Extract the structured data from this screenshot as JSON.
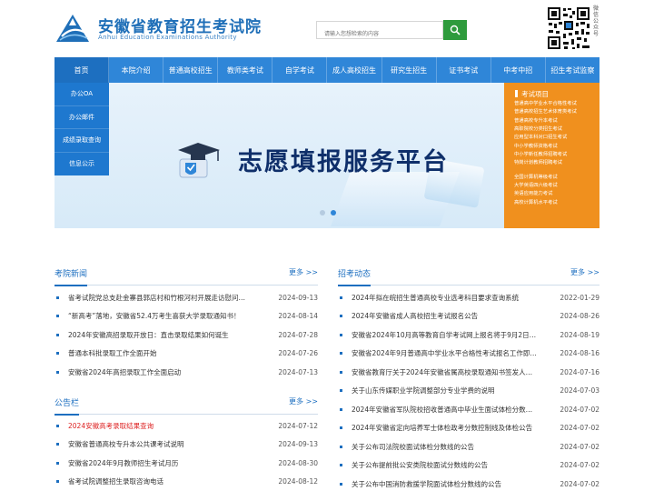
{
  "header": {
    "title": "安徽省教育招生考试院",
    "subtitle": "Anhui Education Examinations Authority",
    "search_placeholder": "请输入您想检索的内容",
    "qr_label": "微信公众号"
  },
  "nav": [
    {
      "label": "首页"
    },
    {
      "label": "本院介绍"
    },
    {
      "label": "普通高校招生"
    },
    {
      "label": "教师类考试"
    },
    {
      "label": "自学考试"
    },
    {
      "label": "成人高校招生"
    },
    {
      "label": "研究生招生"
    },
    {
      "label": "证书考试"
    },
    {
      "label": "中考中招"
    },
    {
      "label": "招生考试监察"
    }
  ],
  "quick_menu": [
    {
      "label": "办公OA"
    },
    {
      "label": "办公邮件"
    },
    {
      "label": "成绩录取查询"
    },
    {
      "label": "信息公示"
    }
  ],
  "banner": {
    "title": "志愿填报服务平台"
  },
  "exam_panel": {
    "title": "考试项目",
    "group1": [
      "普通高中学业水平合格性考试",
      "普通高校招生艺术体育类考试",
      "普通高校专升本考试",
      "高职院校分类招生考试",
      "应用型本科对口招生考试",
      "中小学教师资格考试",
      "中小学新任教师招聘考试",
      "特岗计划教师招聘考试"
    ],
    "group2": [
      "全国计算机等级考试",
      "大学英语四六级考试",
      "英语应用能力考试",
      "高校计算机水平考试"
    ]
  },
  "news": {
    "title": "考院新闻",
    "more": "更多 >>",
    "items": [
      {
        "title": "省考试院党总支赴金寨县郭店村和竹根河村开展走访慰问…",
        "date": "2024-09-13"
      },
      {
        "title": "“新高考”落地，安徽省52.4万考生喜获大学录取通知书！",
        "date": "2024-08-14"
      },
      {
        "title": "2024年安徽高招录取开放日：直击录取结果如何诞生",
        "date": "2024-07-28"
      },
      {
        "title": "普通本科批录取工作全面开始",
        "date": "2024-07-26"
      },
      {
        "title": "安徽省2024年高招录取工作全面启动",
        "date": "2024-07-13"
      }
    ]
  },
  "notice": {
    "title": "公告栏",
    "more": "更多 >>",
    "items": [
      {
        "title": "2024安徽高考录取结果查询",
        "date": "2024-07-12"
      },
      {
        "title": "安徽省普通高校专升本公共课考试说明",
        "date": "2024-09-13"
      },
      {
        "title": "安徽省2024年9月教师招生考试月历",
        "date": "2024-08-30"
      },
      {
        "title": "省考试院调整招生录取咨询电话",
        "date": "2024-08-12"
      }
    ]
  },
  "admissions": {
    "title": "招考动态",
    "more": "更多 >>",
    "items": [
      {
        "title": "2024年拟在皖招生普通高校专业选考科目要求查询系统",
        "date": "2022-01-29"
      },
      {
        "title": "2024年安徽省成人高校招生考试报名公告",
        "date": "2024-08-26"
      },
      {
        "title": "安徽省2024年10月高等教育自学考试网上报名将于9月2日…",
        "date": "2024-08-19"
      },
      {
        "title": "安徽省2024年9月普通高中学业水平合格性考试报名工作即…",
        "date": "2024-08-16"
      },
      {
        "title": "安徽省教育厅关于2024年安徽省属高校录取通知书签发人…",
        "date": "2024-07-16"
      },
      {
        "title": "关于山东传媒职业学院调整部分专业学费的说明",
        "date": "2024-07-03"
      },
      {
        "title": "2024年安徽省军队院校招收普通高中毕业生面试体检分数…",
        "date": "2024-07-02"
      },
      {
        "title": "2024年安徽省定向培养军士体检政考分数控制线及体检公告",
        "date": "2024-07-02"
      },
      {
        "title": "关于公布司法院校面试体检分数线的公告",
        "date": "2024-07-02"
      },
      {
        "title": "关于公布提前批公安类院校面试分数线的公告",
        "date": "2024-07-02"
      },
      {
        "title": "关于公布中国消防救援学院面试体检分数线的公告",
        "date": "2024-07-02"
      }
    ]
  },
  "colors": {
    "primary": "#2f86d8",
    "dark_primary": "#1d6fc0",
    "exam_panel": "#f0901e",
    "search_button": "#2e9b3c",
    "highlight_red": "#dd2222"
  }
}
